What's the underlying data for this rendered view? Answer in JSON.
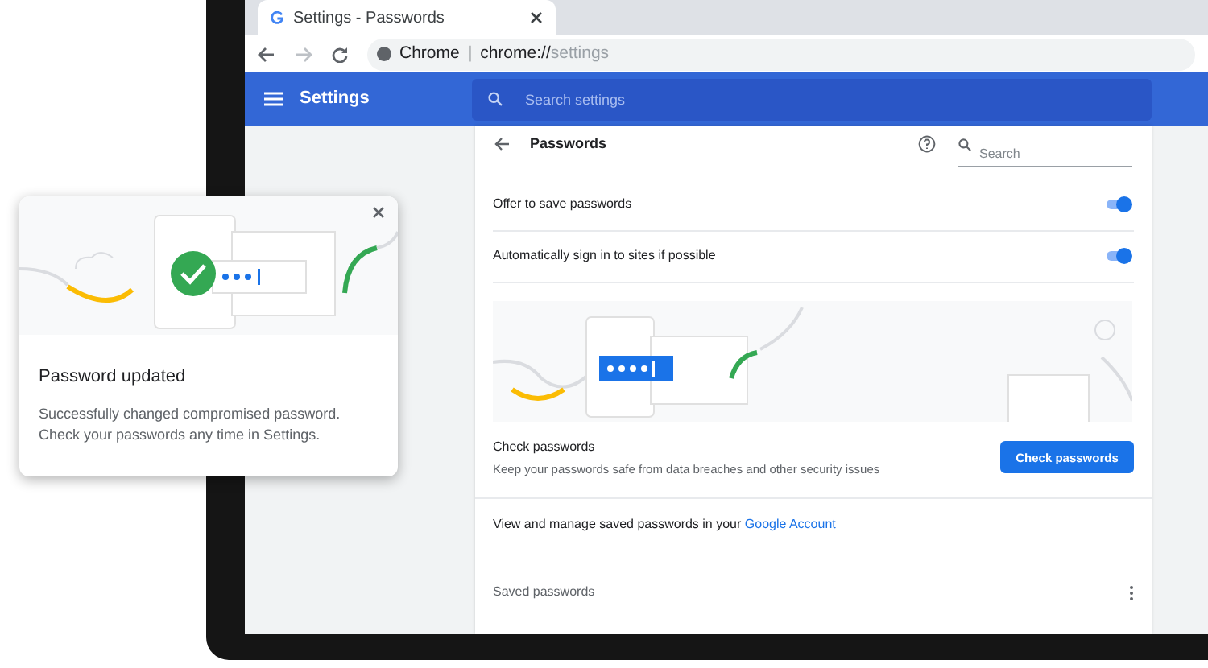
{
  "browser": {
    "tab": {
      "title": "Settings - Passwords",
      "selected": true
    },
    "url": {
      "site": "Chrome",
      "separator": "|",
      "scheme": "chrome://",
      "path": "settings"
    }
  },
  "header": {
    "title": "Settings",
    "search": {
      "placeholder": "Search settings"
    }
  },
  "passwords": {
    "title": "Passwords",
    "search": {
      "placeholder": "Search"
    },
    "toggles": [
      {
        "label": "Offer to save passwords",
        "on": true
      },
      {
        "label": "Automatically sign in to sites if possible",
        "on": true
      }
    ],
    "check": {
      "title": "Check passwords",
      "description": "Keep your passwords safe from data breaches and other security issues",
      "button": "Check passwords"
    },
    "manage": {
      "text": "View and manage saved passwords in your",
      "link": "Google Account"
    },
    "saved": {
      "title": "Saved passwords"
    }
  },
  "popup": {
    "title": "Password updated",
    "message": "Successfully changed compromised password. Check your passwords any time in Settings."
  }
}
